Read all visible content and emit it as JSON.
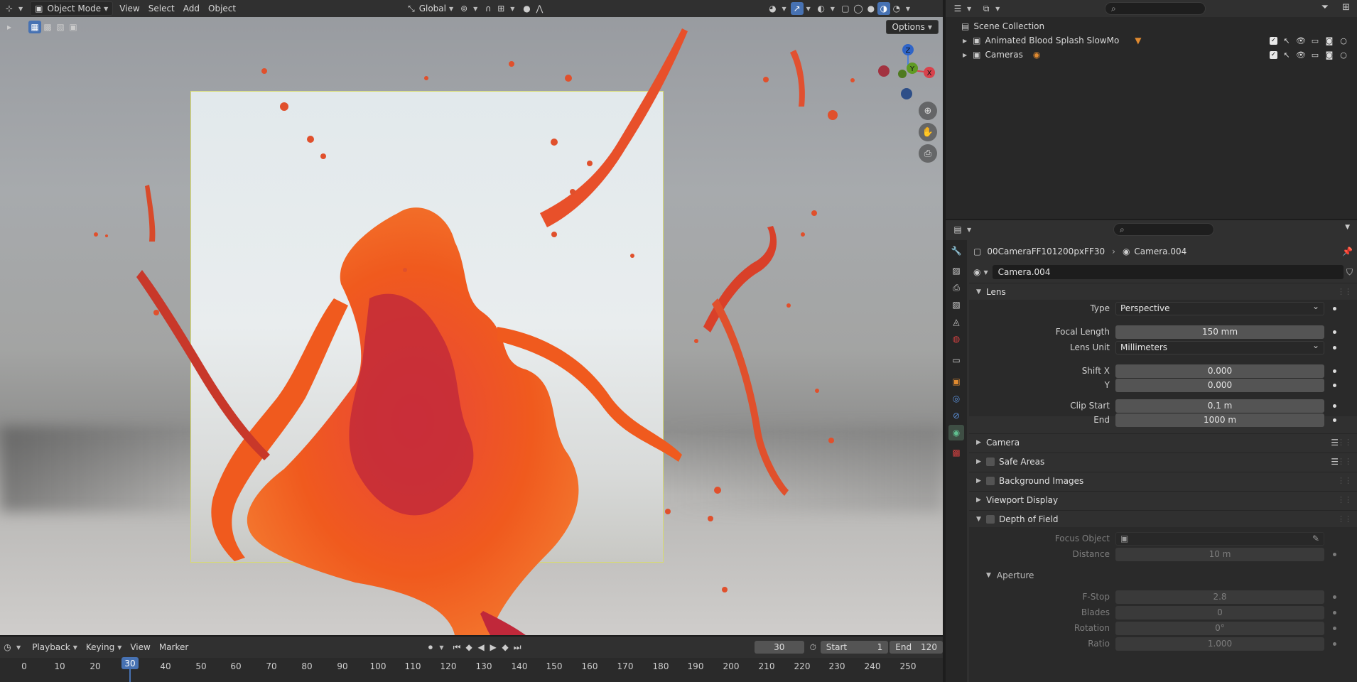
{
  "viewport": {
    "header": {
      "mode_label": "Object Mode",
      "menus": [
        "View",
        "Select",
        "Add",
        "Object"
      ],
      "orientation_label": "Global"
    },
    "options_label": "Options",
    "gizmo": {
      "z": "Z",
      "y": "Y",
      "x": "X"
    },
    "colors": {
      "blood_orange": "#f05a1e",
      "blood_red": "#c0283a",
      "frame_border": "#d8dc70"
    }
  },
  "timeline": {
    "menus": [
      "Playback",
      "Keying",
      "View",
      "Marker"
    ],
    "current_frame": "30",
    "start_label": "Start",
    "start_value": "1",
    "end_label": "End",
    "end_value": "120",
    "ruler": [
      "0",
      "10",
      "20",
      "30",
      "40",
      "50",
      "60",
      "70",
      "80",
      "90",
      "100",
      "110",
      "120",
      "130",
      "140",
      "150",
      "160",
      "170",
      "180",
      "190",
      "200",
      "210",
      "220",
      "230",
      "240",
      "250"
    ],
    "playhead": "30"
  },
  "outliner": {
    "root": "Scene Collection",
    "items": [
      {
        "label": "Animated Blood Splash SlowMo"
      },
      {
        "label": "Cameras"
      }
    ]
  },
  "properties": {
    "breadcrumb_object": "00CameraFF101200pxFF30",
    "breadcrumb_data": "Camera.004",
    "datablock_name": "Camera.004",
    "lens": {
      "title": "Lens",
      "type_label": "Type",
      "type_value": "Perspective",
      "focal_label": "Focal Length",
      "focal_value": "150 mm",
      "unit_label": "Lens Unit",
      "unit_value": "Millimeters",
      "shiftx_label": "Shift X",
      "shiftx_value": "0.000",
      "shifty_label": "Y",
      "shifty_value": "0.000",
      "clipstart_label": "Clip Start",
      "clipstart_value": "0.1 m",
      "clipend_label": "End",
      "clipend_value": "1000 m"
    },
    "panels": {
      "camera": "Camera",
      "safe_areas": "Safe Areas",
      "background_images": "Background Images",
      "viewport_display": "Viewport Display",
      "dof": "Depth of Field"
    },
    "dof": {
      "focus_label": "Focus Object",
      "distance_label": "Distance",
      "distance_value": "10 m",
      "aperture_title": "Aperture",
      "fstop_label": "F-Stop",
      "fstop_value": "2.8",
      "blades_label": "Blades",
      "blades_value": "0",
      "rotation_label": "Rotation",
      "rotation_value": "0°",
      "ratio_label": "Ratio",
      "ratio_value": "1.000"
    }
  }
}
